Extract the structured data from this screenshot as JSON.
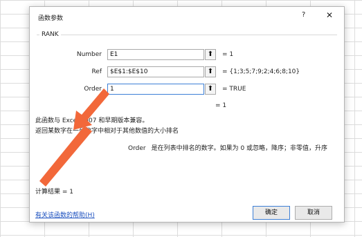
{
  "dialog": {
    "title": "函数参数",
    "help_glyph": "?",
    "close_glyph": "✕"
  },
  "function_group": {
    "name": "RANK",
    "fields": [
      {
        "label": "Number",
        "value": "E1",
        "result": "=  1"
      },
      {
        "label": "Ref",
        "value": "$E$1:$E$10",
        "result": "=  {1;3;5;7;9;2;4;6;8;10}"
      },
      {
        "label": "Order",
        "value": "1",
        "result": "=  TRUE"
      }
    ],
    "ref_glyph": "⬆",
    "total_result": "=  1"
  },
  "description": {
    "line1": "此函数与 Excel 2007 和早期版本兼容。",
    "line2": "返回某数字在一列数字中相对于其他数值的大小排名",
    "param_name": "Order",
    "param_text": "是在列表中排名的数字。如果为 0 或忽略，降序；非零值，升序"
  },
  "footer": {
    "calc_result": "计算结果 =  1",
    "help_link": "有关该函数的帮助(H)",
    "ok_label": "确定",
    "cancel_label": "取消"
  },
  "colors": {
    "annotation_arrow": "#f2683a",
    "focus_border": "#3c7fd6",
    "link": "#1a4fbf"
  }
}
